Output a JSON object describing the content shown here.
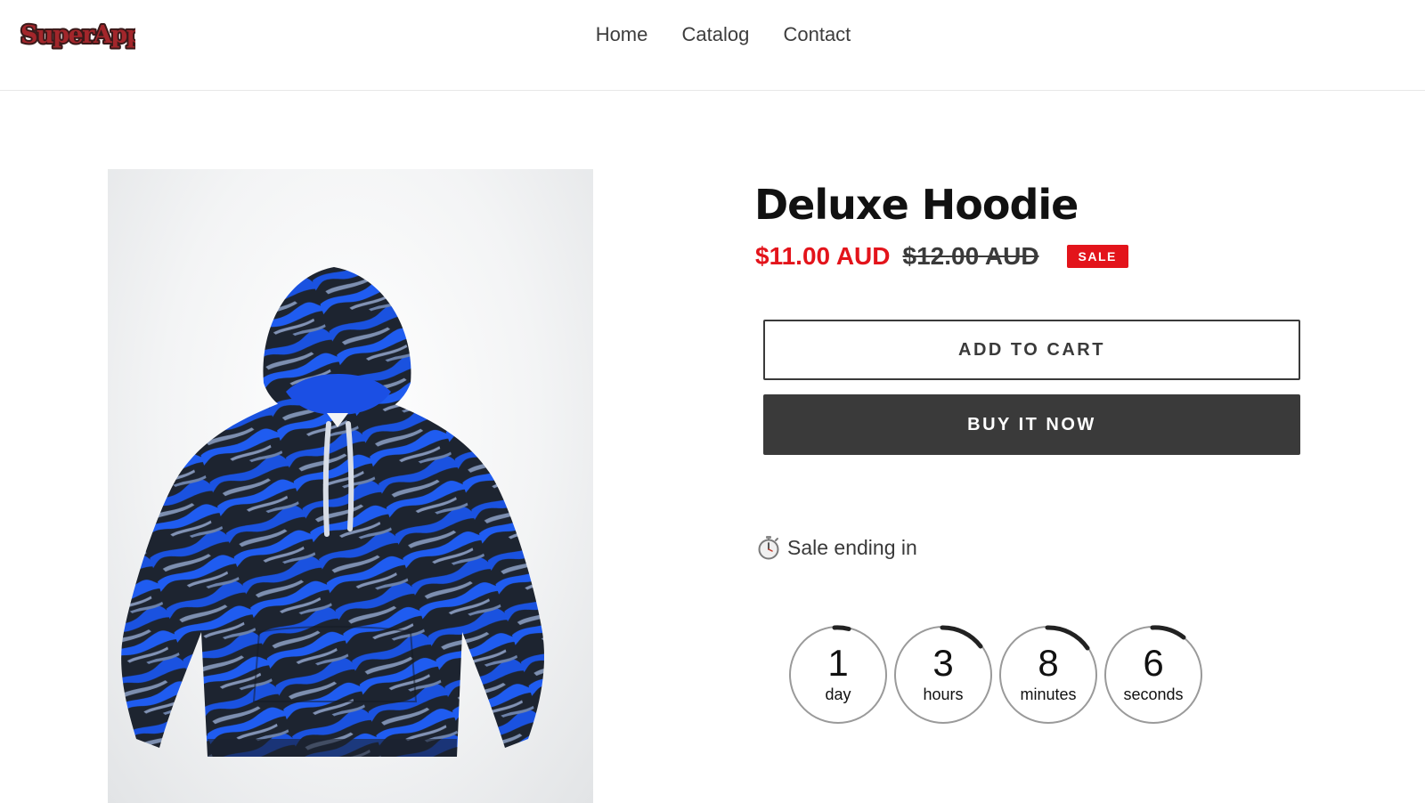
{
  "header": {
    "logo_text": "SuperApps",
    "nav": [
      "Home",
      "Catalog",
      "Contact"
    ]
  },
  "product": {
    "title": "Deluxe Hoodie",
    "sale_price": "$11.00 AUD",
    "regular_price": "$12.00 AUD",
    "badge": "SALE",
    "image_icon": "hoodie-image",
    "add_to_cart_label": "ADD TO CART",
    "buy_now_label": "BUY IT NOW"
  },
  "countdown": {
    "heading": "Sale ending in",
    "heading_icon": "stopwatch-icon",
    "units": [
      {
        "value": "1",
        "label": "day"
      },
      {
        "value": "3",
        "label": "hours"
      },
      {
        "value": "8",
        "label": "minutes"
      },
      {
        "value": "6",
        "label": "seconds"
      }
    ]
  },
  "colors": {
    "sale_red": "#e3141b",
    "text_dark": "#3a3a3a",
    "button_dark": "#3a3a3a"
  }
}
